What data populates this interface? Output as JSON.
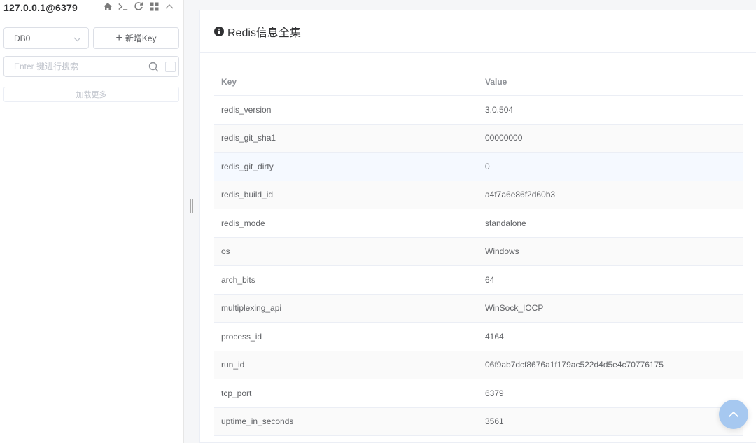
{
  "connection": {
    "title": "127.0.0.1@6379",
    "icons": [
      "home-icon",
      "terminal-icon",
      "refresh-icon",
      "grid-icon",
      "collapse-icon"
    ]
  },
  "sidebar": {
    "db_select_value": "DB0",
    "add_key_label": "新增Key",
    "search_placeholder": "Enter 键进行搜索",
    "load_more_label": "加载更多"
  },
  "main": {
    "title": "Redis信息全集",
    "table": {
      "headers": {
        "key": "Key",
        "value": "Value"
      },
      "rows": [
        {
          "key": "redis_version",
          "value": "3.0.504"
        },
        {
          "key": "redis_git_sha1",
          "value": "00000000"
        },
        {
          "key": "redis_git_dirty",
          "value": "0"
        },
        {
          "key": "redis_build_id",
          "value": "a4f7a6e86f2d60b3"
        },
        {
          "key": "redis_mode",
          "value": "standalone"
        },
        {
          "key": "os",
          "value": "Windows"
        },
        {
          "key": "arch_bits",
          "value": "64"
        },
        {
          "key": "multiplexing_api",
          "value": "WinSock_IOCP"
        },
        {
          "key": "process_id",
          "value": "4164"
        },
        {
          "key": "run_id",
          "value": "06f9ab7dcf8676a1f179ac522d4d5e4c70776175"
        },
        {
          "key": "tcp_port",
          "value": "6379"
        },
        {
          "key": "uptime_in_seconds",
          "value": "3561"
        }
      ]
    }
  },
  "colors": {
    "accent": "#409eff",
    "fab": "#a6c8f0",
    "border": "#dcdfe6",
    "text": "#606266"
  }
}
